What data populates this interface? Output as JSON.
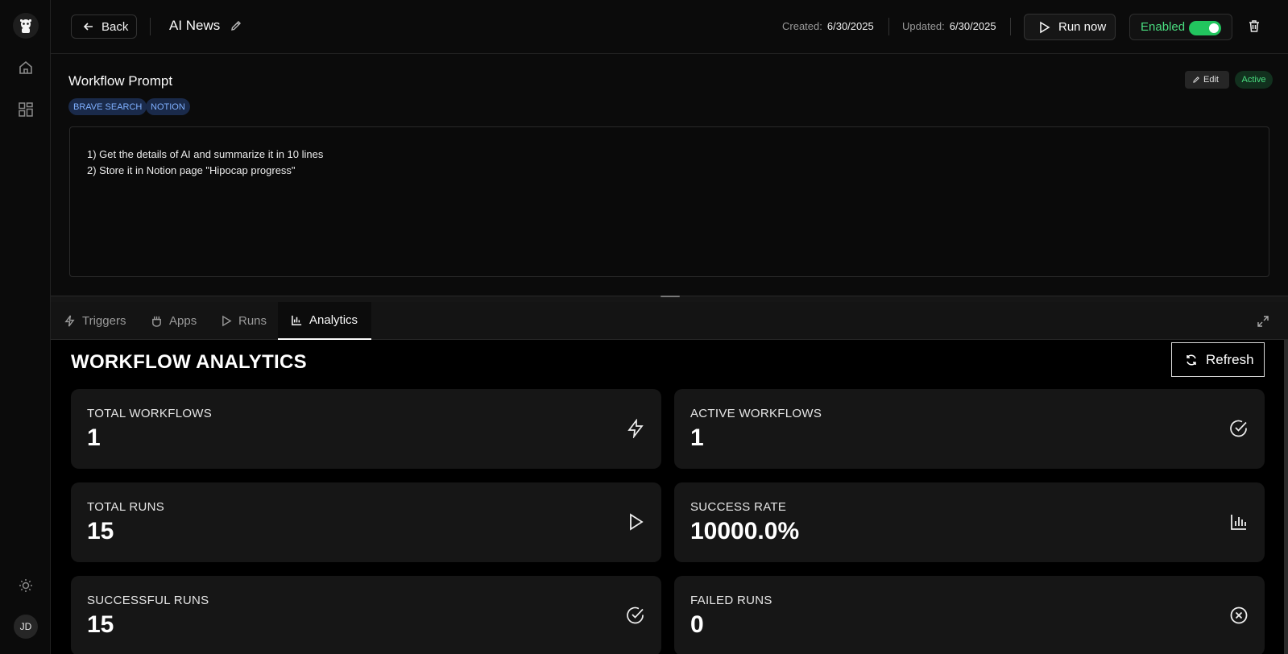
{
  "header": {
    "back_label": "Back",
    "workflow_title": "AI News",
    "created_label": "Created:",
    "created_value": "6/30/2025",
    "updated_label": "Updated:",
    "updated_value": "6/30/2025",
    "run_now_label": "Run now",
    "enabled_label": "Enabled",
    "enabled_on": true
  },
  "sidebar": {
    "avatar_initials": "JD",
    "items": [
      "home-icon",
      "apps-grid-icon",
      "theme-toggle-icon"
    ]
  },
  "prompt": {
    "title": "Workflow Prompt",
    "tags": [
      "BRAVE SEARCH",
      "NOTION"
    ],
    "edit_label": "Edit",
    "status_label": "Active",
    "lines": [
      "1) Get the details of  AI and summarize it in 10 lines",
      "2) Store it in Notion page \"Hipocap progress\""
    ]
  },
  "tabs": [
    {
      "label": "Triggers",
      "icon": "bolt-icon"
    },
    {
      "label": "Apps",
      "icon": "apps-icon"
    },
    {
      "label": "Runs",
      "icon": "play-icon"
    },
    {
      "label": "Analytics",
      "icon": "bar-chart-icon",
      "active": true
    }
  ],
  "analytics": {
    "title": "WORKFLOW ANALYTICS",
    "refresh_label": "Refresh",
    "cards": [
      {
        "label": "TOTAL WORKFLOWS",
        "value": "1",
        "icon": "bolt-icon"
      },
      {
        "label": "ACTIVE WORKFLOWS",
        "value": "1",
        "icon": "check-circle-icon"
      },
      {
        "label": "TOTAL RUNS",
        "value": "15",
        "icon": "play-icon"
      },
      {
        "label": "SUCCESS RATE",
        "value": "10000.0%",
        "icon": "bar-chart-icon"
      },
      {
        "label": "SUCCESSFUL RUNS",
        "value": "15",
        "icon": "check-circle-icon"
      },
      {
        "label": "FAILED RUNS",
        "value": "0",
        "icon": "x-circle-icon"
      }
    ]
  },
  "colors": {
    "background": "#0a0a0a",
    "accent_green": "#22c55e",
    "tag_blue": "#7fb0ff",
    "card_bg": "#161616"
  }
}
